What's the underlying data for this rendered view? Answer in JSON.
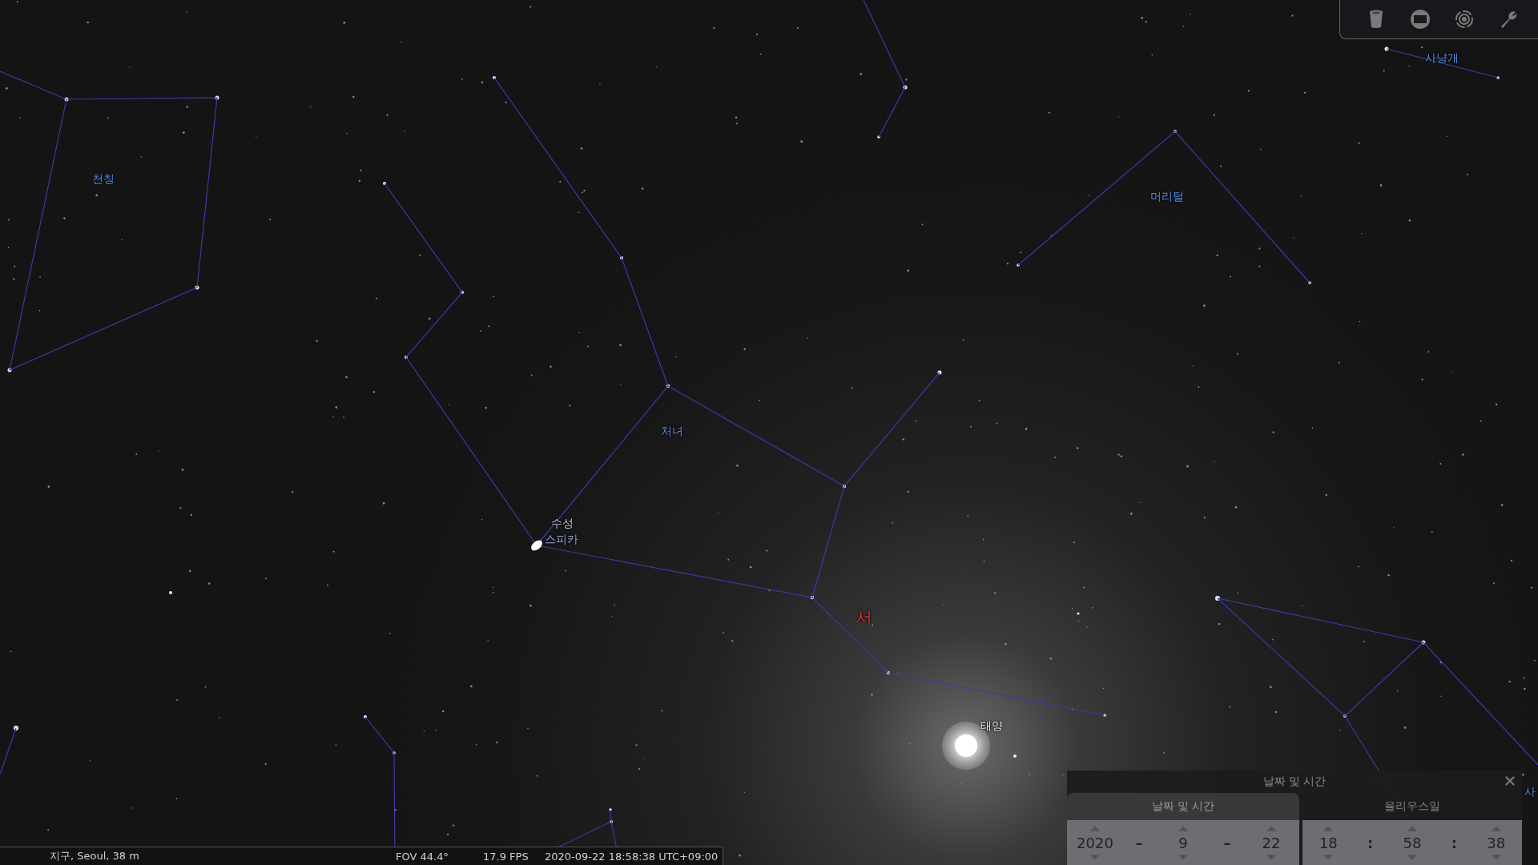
{
  "sky_labels": [
    {
      "kind": "constellation",
      "text": "천칭"
    },
    {
      "kind": "constellation",
      "text": "처녀"
    },
    {
      "kind": "constellation",
      "text": "머리털"
    },
    {
      "kind": "constellation",
      "text": "사냥개"
    },
    {
      "kind": "constellation",
      "text": "사"
    },
    {
      "kind": "planet",
      "text": "수성"
    },
    {
      "kind": "star",
      "text": "스피카"
    },
    {
      "kind": "sun",
      "text": "태양"
    },
    {
      "kind": "cardinal",
      "text": "서"
    }
  ],
  "toolbar": [
    {
      "kind": "bucket"
    },
    {
      "kind": "screen"
    },
    {
      "kind": "target"
    },
    {
      "kind": "wrench"
    }
  ],
  "status_bar": {
    "location": "지구, Seoul, 38 m",
    "fov": "FOV 44.4°",
    "fps": "17.9 FPS",
    "datetime": "2020-09-22 18:58:38 UTC+09:00"
  },
  "date_dialog": {
    "title": "날짜 및 시간",
    "tabs": [
      {
        "label": "날짜 및 시간",
        "selected": true
      },
      {
        "label": "율리우스일",
        "selected": false
      }
    ],
    "date_fields": [
      "2020",
      "9",
      "22"
    ],
    "date_separator": "–",
    "time_fields": [
      "18",
      "58",
      "38"
    ],
    "time_separator": ":"
  }
}
